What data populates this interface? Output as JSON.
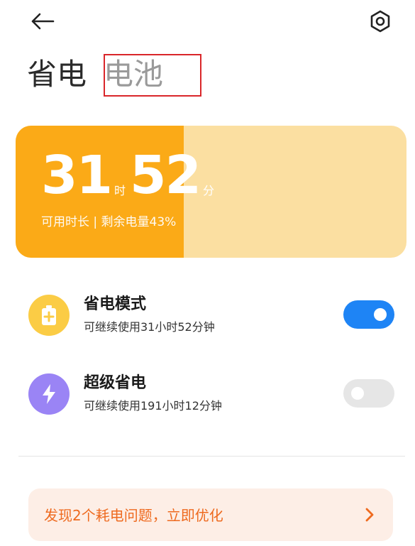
{
  "header": {
    "back_icon": "arrow-left-icon",
    "settings_icon": "gear-icon"
  },
  "tabs": [
    {
      "label": "省电",
      "active": true
    },
    {
      "label": "电池",
      "active": false
    }
  ],
  "battery": {
    "hours": "31",
    "hours_unit": "时",
    "minutes": "52",
    "minutes_unit": "分",
    "subtitle": "可用时长 | 剩余电量43%",
    "level_percent": 43,
    "fill_color": "#fbaa17",
    "track_color": "#fbdfa1"
  },
  "modes": [
    {
      "title": "省电模式",
      "subtitle": "可继续使用31小时52分钟",
      "icon": "battery-plus-icon",
      "icon_color": "#fbcc45",
      "enabled": true
    },
    {
      "title": "超级省电",
      "subtitle": "可继续使用191小时12分钟",
      "icon": "lightning-icon",
      "icon_color": "#9a84f5",
      "enabled": false
    }
  ],
  "optimize": {
    "label": "发现2个耗电问题，立即优化",
    "icon": "chevron-right-icon",
    "text_color": "#ee6a1f"
  },
  "colors": {
    "toggle_on": "#1e84f5",
    "toggle_off": "#e6e6e6"
  }
}
